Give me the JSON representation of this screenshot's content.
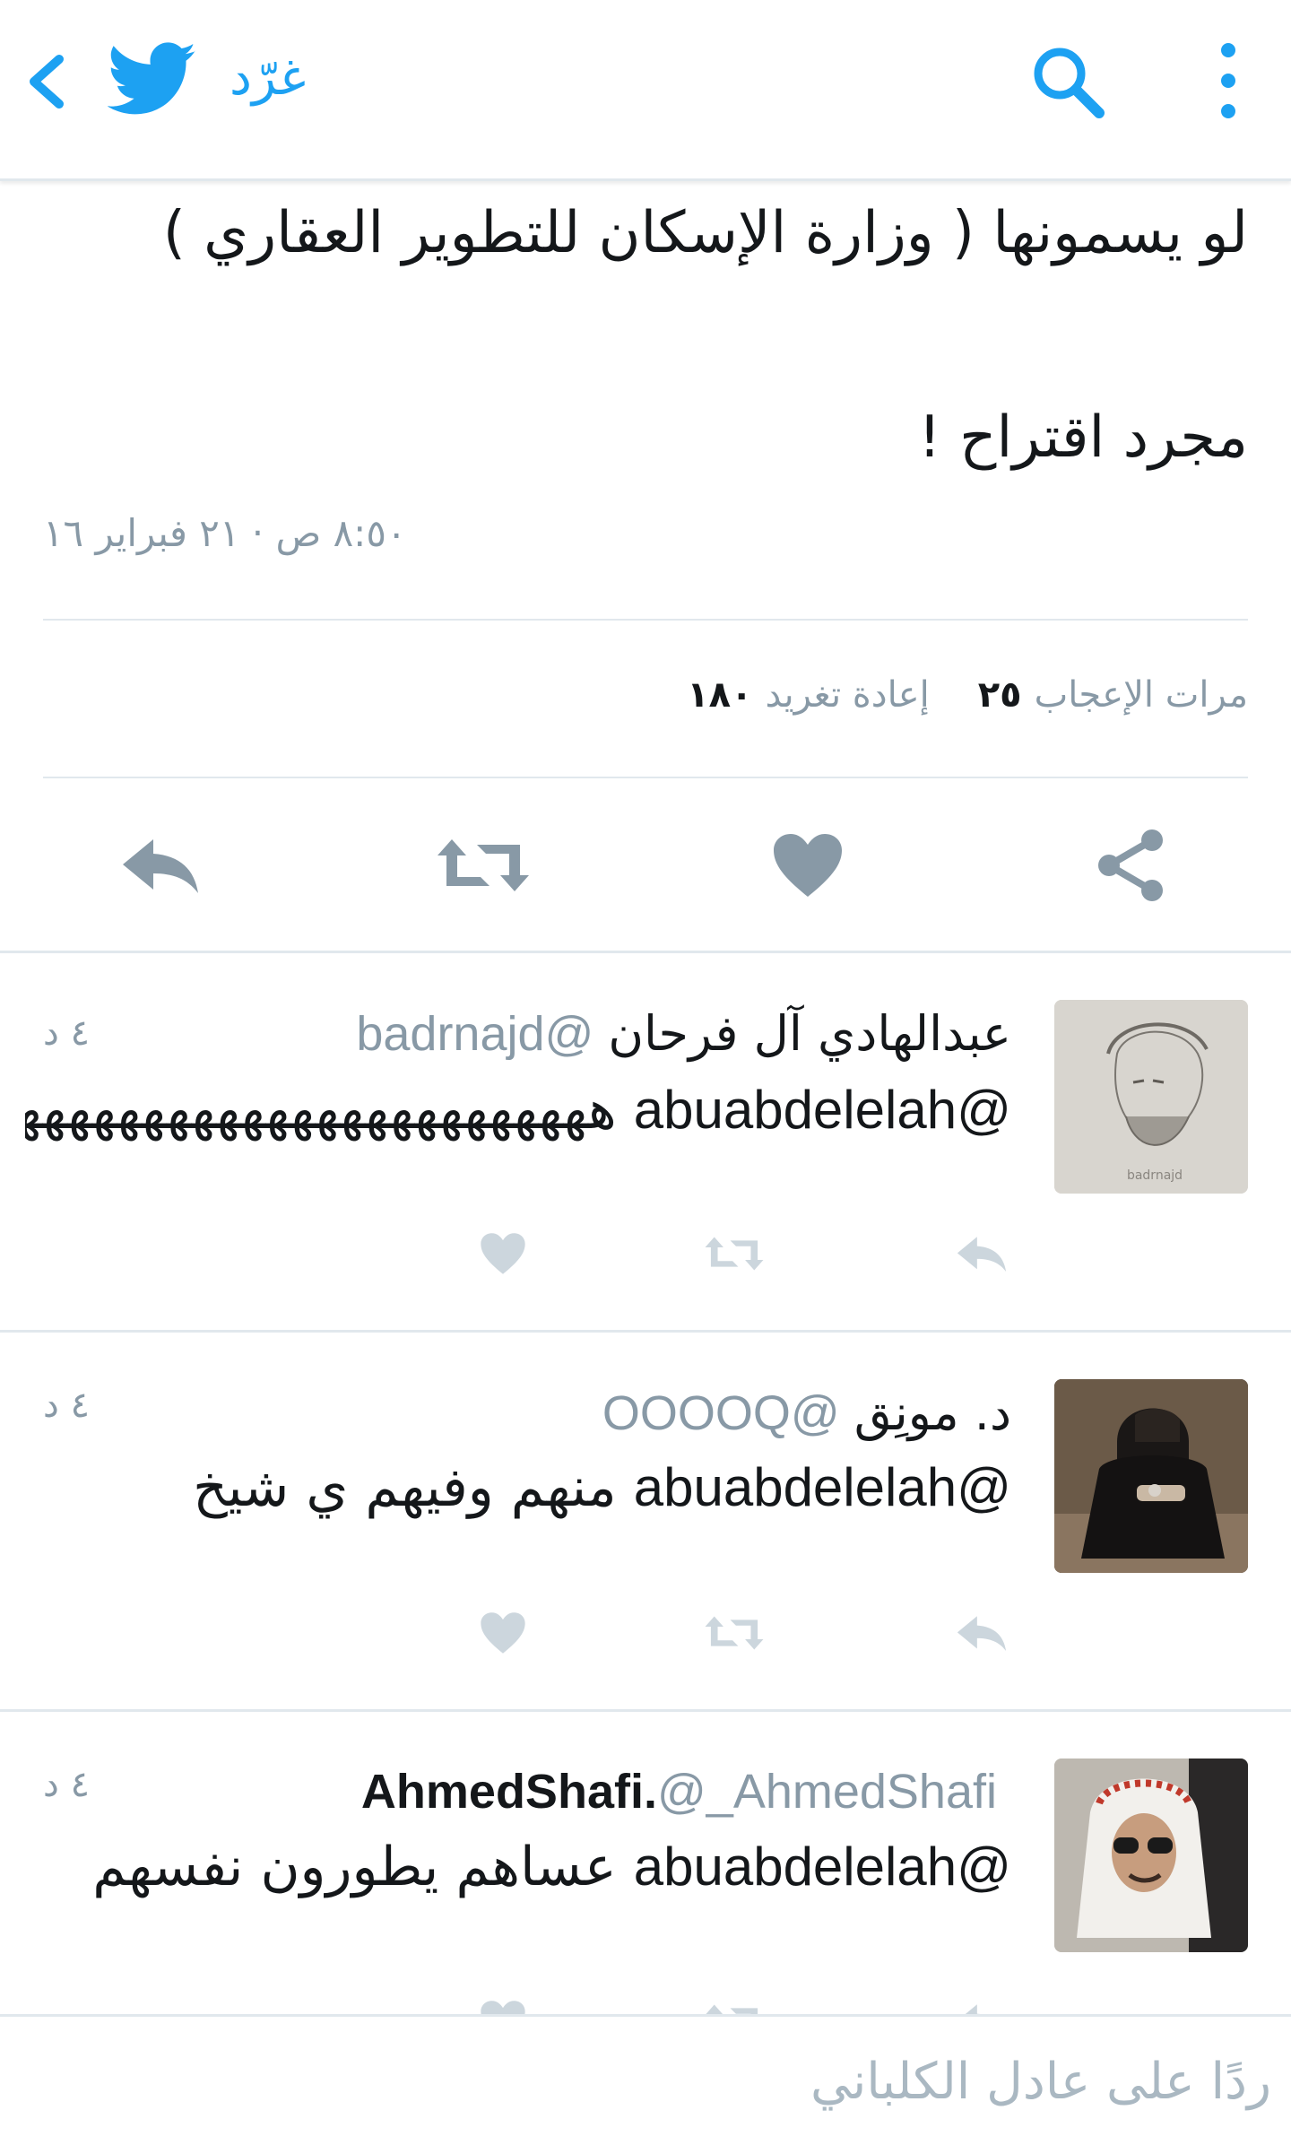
{
  "header": {
    "tweet_label": "غرّد",
    "back_icon": "chevron-left-icon",
    "logo_icon": "twitter-bird-icon",
    "search_icon": "search-icon",
    "more_icon": "more-vertical-icon",
    "accent_color": "#1DA1F2"
  },
  "tweet": {
    "line1": "لو يسمونها ( وزارة الإسكان للتطوير العقاري )",
    "line2": "مجرد اقتراح !",
    "timestamp": "٨:٥٠ ص · ٢١ فبراير ١٦",
    "retweets_count": "١٨٠",
    "retweets_label": "إعادة تغريد",
    "likes_count": "٢٥",
    "likes_label": "مرات الإعجاب"
  },
  "replies": [
    {
      "name": "عبدالهادي آل فرحان",
      "handle": "@badrnajd",
      "time": "٤ د",
      "mention": "@abuabdelelah",
      "text": "هههههههههههههههههههههههههههه",
      "avatar_caption": "badrnajd"
    },
    {
      "name": "د. مونِق",
      "handle": "@OOOOQ",
      "time": "٤ د",
      "mention": "@abuabdelelah",
      "text": "منهم وفيهم ي شيخ"
    },
    {
      "name": "AhmedShafi.",
      "handle": "@_AhmedShafi",
      "time": "٤ د",
      "mention": "@abuabdelelah",
      "text": "عساهم يطورون نفسهم"
    }
  ],
  "compose": {
    "placeholder": "ردًا على عادل الكلباني"
  }
}
